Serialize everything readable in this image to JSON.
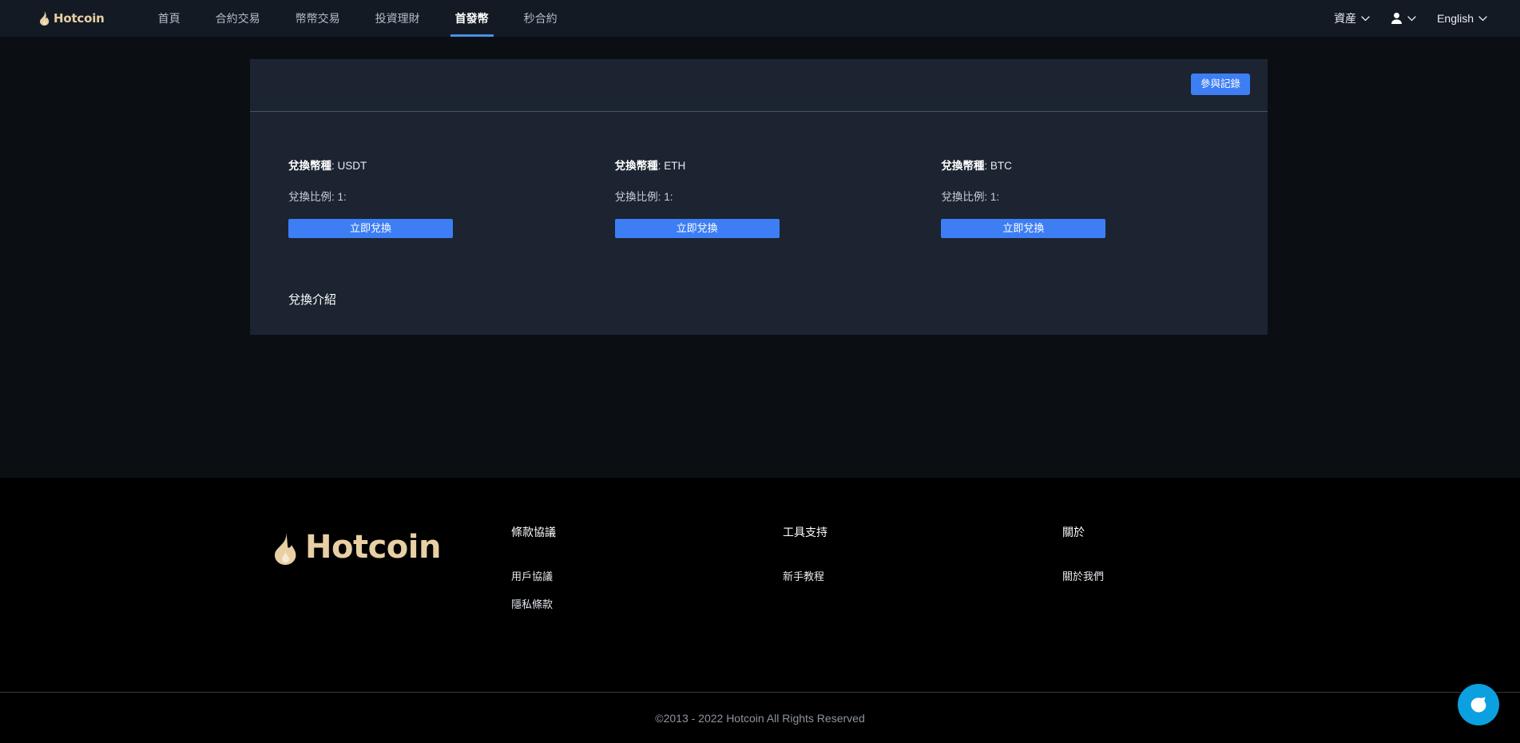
{
  "header": {
    "brand": {
      "text": "Hotcoin",
      "icon": "flame-icon"
    },
    "nav": [
      {
        "label": "首頁",
        "active": false
      },
      {
        "label": "合約交易",
        "active": false
      },
      {
        "label": "幣幣交易",
        "active": false
      },
      {
        "label": "投資理財",
        "active": false
      },
      {
        "label": "首發幣",
        "active": true
      },
      {
        "label": "秒合約",
        "active": false
      }
    ],
    "right": [
      {
        "label": "資産",
        "icon": "chevron-down-icon",
        "name": "assets-menu"
      },
      {
        "label": "",
        "icon": "user-icon",
        "name": "account-menu"
      },
      {
        "label": "English",
        "icon": "chevron-down-icon",
        "name": "language-menu"
      }
    ]
  },
  "main": {
    "record_button": "參與記錄",
    "coins": [
      {
        "currency_label": "兌換幣種",
        "currency_value": "USDT",
        "ratio_label": "兌換比例",
        "ratio_value": "1:",
        "swap_button": "立即兌換"
      },
      {
        "currency_label": "兌換幣種",
        "currency_value": "ETH",
        "ratio_label": "兌換比例",
        "ratio_value": "1:",
        "swap_button": "立即兌換"
      },
      {
        "currency_label": "兌換幣種",
        "currency_value": "BTC",
        "ratio_label": "兌換比例",
        "ratio_value": "1:",
        "swap_button": "立即兌換"
      }
    ],
    "intro_title": "兌換介紹"
  },
  "footer": {
    "logo_text": "Hotcoin",
    "columns": [
      {
        "title": "條款協議",
        "links": [
          "用戶協議",
          "隱私條款"
        ]
      },
      {
        "title": "工具支持",
        "links": [
          "新手教程"
        ]
      },
      {
        "title": "關於",
        "links": [
          "關於我們"
        ]
      }
    ],
    "copyright": "©2013 - 2022 Hotcoin All Rights Reserved"
  },
  "chat": {
    "icon": "chat-bubble-icon"
  },
  "colors": {
    "page_background": "#0b0f14",
    "header_background": "#131a24",
    "card_background": "#1b2430",
    "accent_blue": "#3d7ef5",
    "nav_active_underline": "#4a90e8",
    "brand_gold": "#e8cfa4",
    "footer_background": "#000000",
    "chat_blue": "#0ba0e0"
  }
}
